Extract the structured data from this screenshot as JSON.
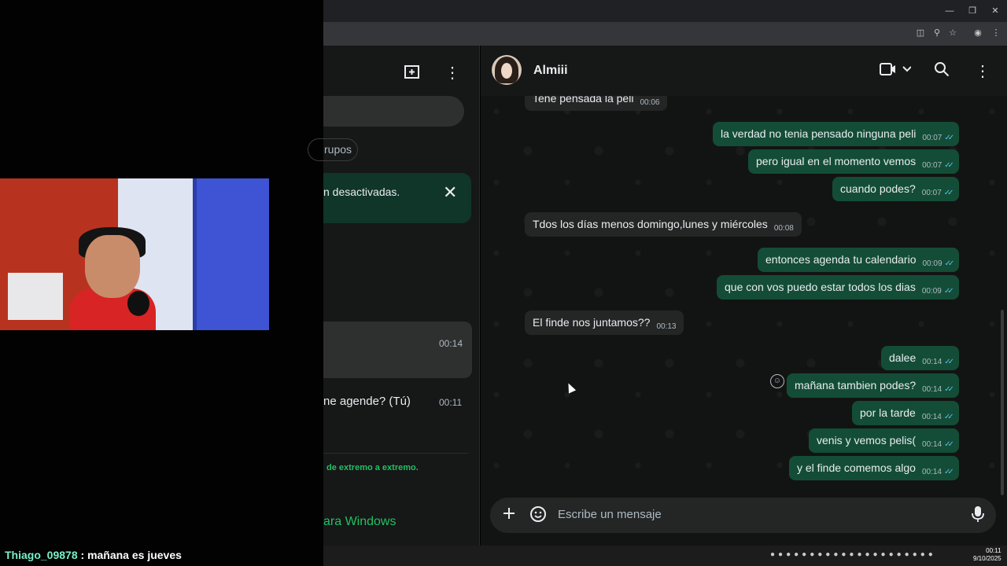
{
  "stream": {
    "chat_user": "Thiago_09878",
    "chat_message": "mañana es jueves"
  },
  "sidebar": {
    "filter_chip": "rupos",
    "notice_text": "n desactivadas.",
    "notice_close_icon": "close-icon",
    "active_chat_time": "00:14",
    "second_chat_preview": "ne agende? (Tú)",
    "second_chat_time": "00:11",
    "e2e_text": "de extremo a extremo.",
    "windows_text": "ara Windows"
  },
  "chat": {
    "contact_name": "Almiii",
    "composer_placeholder": "Escribe un mensaje",
    "messages": [
      {
        "dir": "in",
        "text": "Tene pensada la peli",
        "time": "00:06"
      },
      {
        "dir": "out",
        "text": "la verdad no tenia pensado ninguna peli",
        "time": "00:07"
      },
      {
        "dir": "out",
        "text": "pero igual en el momento vemos",
        "time": "00:07"
      },
      {
        "dir": "out",
        "text": "cuando podes?",
        "time": "00:07"
      },
      {
        "dir": "in",
        "text": "Tdos los días menos domingo,lunes y miércoles",
        "time": "00:08"
      },
      {
        "dir": "out",
        "text": "entonces agenda tu calendario",
        "time": "00:09"
      },
      {
        "dir": "out",
        "text": "que con vos puedo estar todos los dias",
        "time": "00:09"
      },
      {
        "dir": "in",
        "text": "El finde nos juntamos??",
        "time": "00:13"
      },
      {
        "dir": "out",
        "text": "dalee",
        "time": "00:14"
      },
      {
        "dir": "out",
        "text": "mañana tambien podes?",
        "time": "00:14"
      },
      {
        "dir": "out",
        "text": "por la tarde",
        "time": "00:14"
      },
      {
        "dir": "out",
        "text": "venis y vemos pelis(",
        "time": "00:14"
      },
      {
        "dir": "out",
        "text": "y el finde comemos algo",
        "time": "00:14"
      }
    ]
  },
  "taskbar": {
    "time": "00:11",
    "date": "9/10/2025"
  },
  "colors": {
    "outgoing_bubble": "#144d37",
    "incoming_bubble": "#242626",
    "accent_green": "#21c063",
    "read_ticks": "#53bdeb"
  }
}
